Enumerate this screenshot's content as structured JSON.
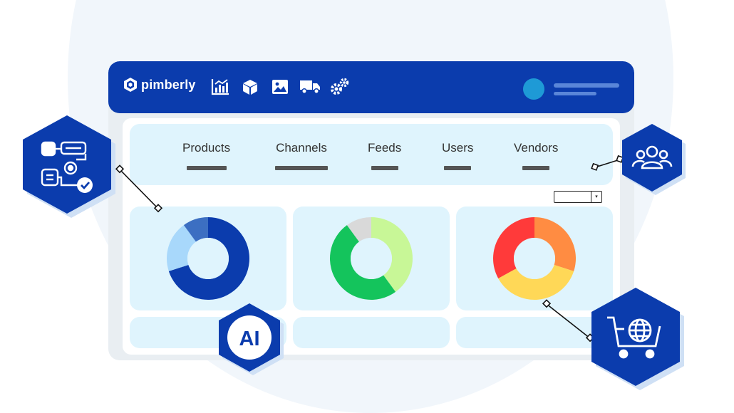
{
  "app": {
    "brand": "pimberly",
    "colors": {
      "primary": "#0b3cad",
      "panel": "#dff4fd",
      "avatar": "#1e9ad6"
    }
  },
  "toolbar": {
    "icons": [
      "analytics-chart-icon",
      "product-box-icon",
      "image-icon",
      "delivery-truck-icon",
      "settings-gears-icon"
    ]
  },
  "tabs": [
    {
      "label": "Products"
    },
    {
      "label": "Channels"
    },
    {
      "label": "Feeds"
    },
    {
      "label": "Users"
    },
    {
      "label": "Vendors"
    }
  ],
  "charts": [
    {
      "type": "donut",
      "segments": [
        {
          "share": 0.7,
          "color": "#0b3cad"
        },
        {
          "share": 0.2,
          "color": "#a8d8fb"
        },
        {
          "share": 0.1,
          "color": "#3c6fc2"
        }
      ]
    },
    {
      "type": "donut",
      "segments": [
        {
          "share": 0.4,
          "color": "#c8f797"
        },
        {
          "share": 0.5,
          "color": "#14c45c"
        },
        {
          "share": 0.1,
          "color": "#d9d9d9"
        }
      ]
    },
    {
      "type": "donut",
      "segments": [
        {
          "share": 0.3,
          "color": "#ff8c42"
        },
        {
          "share": 0.37,
          "color": "#ffd857"
        },
        {
          "share": 0.33,
          "color": "#ff3a3a"
        }
      ]
    }
  ],
  "badges": {
    "workflow": "workflow-automation-icon",
    "users": "users-group-icon",
    "ai": "AI",
    "commerce": "ecommerce-cart-globe-icon"
  }
}
